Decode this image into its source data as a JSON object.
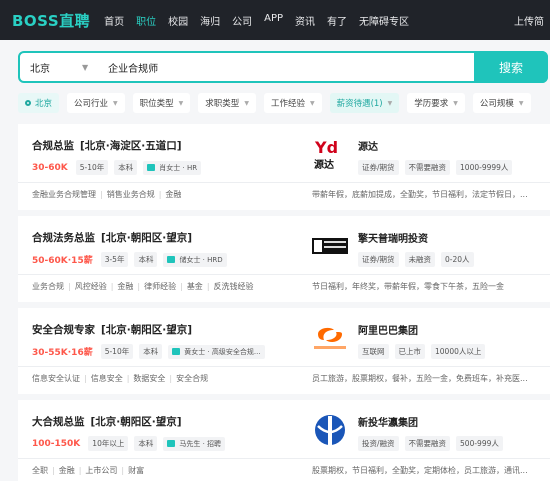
{
  "nav": {
    "logo": "BOSS直聘",
    "links": [
      "首页",
      "职位",
      "校园",
      "海归",
      "公司",
      "APP",
      "资讯",
      "有了",
      "无障碍专区"
    ],
    "active_index": 1,
    "upload": "上传简"
  },
  "search": {
    "city": "北京",
    "keyword": "企业合规师",
    "map_label": "地图",
    "button": "搜索"
  },
  "filters": [
    "北京",
    "公司行业",
    "职位类型",
    "求职类型",
    "工作经验",
    "薪资待遇(1)",
    "学历要求",
    "公司规模"
  ],
  "jobs": [
    {
      "title": "合规总监",
      "location": "[北京·海淀区·五道口]",
      "salary": "30-60K",
      "tags": [
        "5-10年",
        "本科"
      ],
      "hr": "肖女士 · HR",
      "company": "源达",
      "company_tags": [
        "证券/期货",
        "不需要融资",
        "1000-9999人"
      ],
      "skills": [
        "金融业务合规管理",
        "销售业务合规",
        "金融"
      ],
      "benefits": "带薪年假，底薪加提成，全勤奖，节日福利，法定节假日，..."
    },
    {
      "title": "合规法务总监",
      "location": "[北京·朝阳区·望京]",
      "salary": "50-60K·15薪",
      "tags": [
        "3-5年",
        "本科"
      ],
      "hr": "储女士 · HRD",
      "company": "擎天普瑞明投资",
      "company_tags": [
        "证券/期货",
        "未融资",
        "0-20人"
      ],
      "skills": [
        "业务合规",
        "风控经验",
        "金融",
        "律师经验",
        "基金",
        "反洗钱经验"
      ],
      "benefits": "节日福利，年终奖，带薪年假，零食下午茶，五险一金"
    },
    {
      "title": "安全合规专家",
      "location": "[北京·朝阳区·望京]",
      "salary": "30-55K·16薪",
      "tags": [
        "5-10年",
        "本科"
      ],
      "hr": "黄女士 · 高级安全合规...",
      "company": "阿里巴巴集团",
      "company_tags": [
        "互联网",
        "已上市",
        "10000人以上"
      ],
      "skills": [
        "信息安全认证",
        "信息安全",
        "数据安全",
        "安全合规"
      ],
      "benefits": "员工旅游，股票期权，餐补，五险一金，免费班车，补充医..."
    },
    {
      "title": "大合规总监",
      "location": "[北京·朝阳区·望京]",
      "salary": "100-150K",
      "tags": [
        "10年以上",
        "本科"
      ],
      "hr": "马先生 · 招聘",
      "company": "新投华瀛集团",
      "company_tags": [
        "投资/融资",
        "不需要融资",
        "500-999人"
      ],
      "skills": [
        "全职",
        "金融",
        "上市公司",
        "财富"
      ],
      "benefits": "股票期权，节日福利，全勤奖，定期体检，员工旅游，通讯..."
    }
  ]
}
